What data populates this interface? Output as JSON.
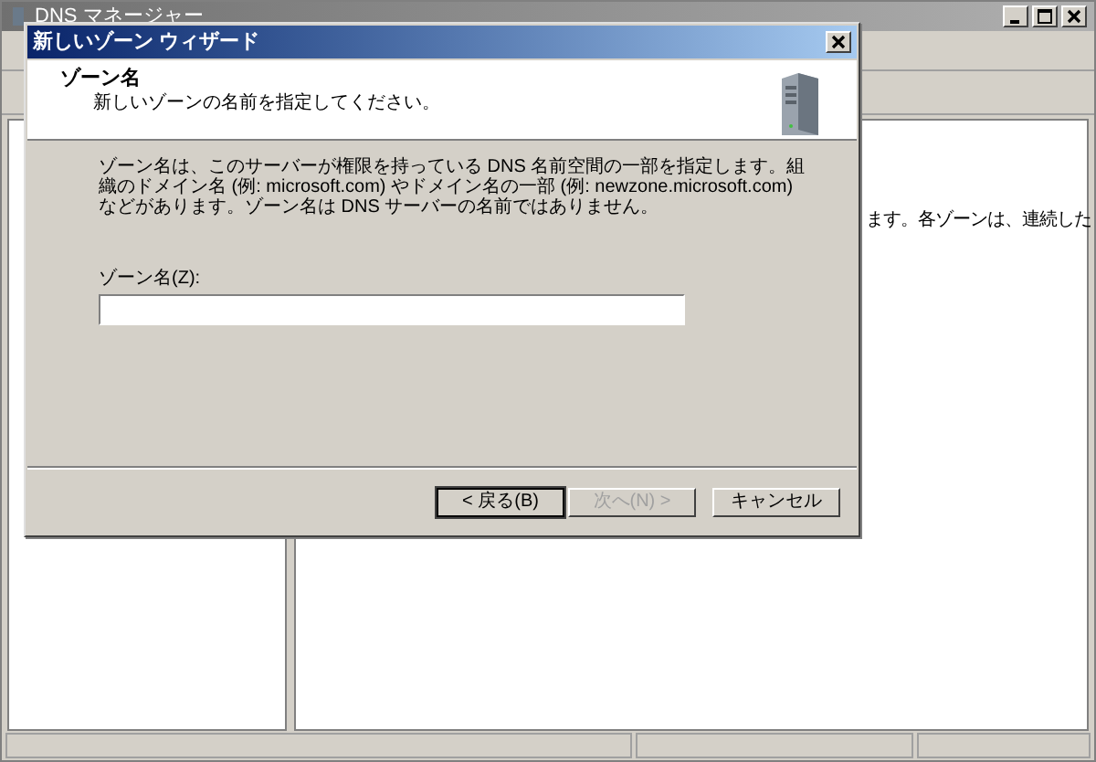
{
  "background_window": {
    "title": "DNS マネージャー",
    "right_pane_text": "ます。各ゾーンは、連続した"
  },
  "dialog": {
    "title": "新しいゾーン ウィザード",
    "header_title": "ゾーン名",
    "header_subtitle": "新しいゾーンの名前を指定してください。",
    "description": "ゾーン名は、このサーバーが権限を持っている DNS 名前空間の一部を指定します。組織のドメイン名 (例: microsoft.com) やドメイン名の一部 (例: newzone.microsoft.com) などがあります。ゾーン名は DNS サーバーの名前ではありません。",
    "field": {
      "label": "ゾーン名(Z):"
    },
    "buttons": [
      {
        "label": "< 戻る(B)",
        "disabled": false,
        "default": true
      },
      {
        "label": "次へ(N) >",
        "disabled": true,
        "default": false
      },
      {
        "label": "キャンセル",
        "disabled": false,
        "default": false
      }
    ]
  }
}
